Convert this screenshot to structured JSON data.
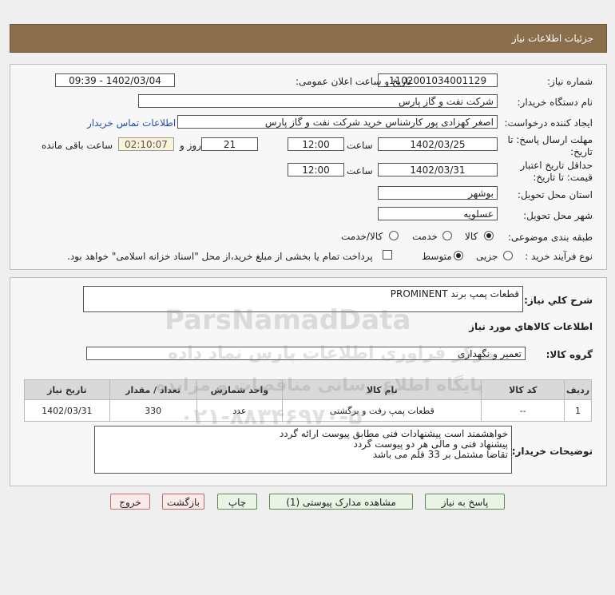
{
  "header": {
    "title": "جزئیات اطلاعات نیاز"
  },
  "form": {
    "need_number_label": "شماره نیاز:",
    "need_number": "1102001034001129",
    "announce_label": "تاریخ و ساعت اعلان عمومی:",
    "announce_value": "1402/03/04 - 09:39",
    "buyer_org_label": "نام دستگاه خریدار:",
    "buyer_org": "شرکت نفت و گاز پارس",
    "creator_label": "ایجاد کننده درخواست:",
    "creator": "اصغر کهزادی پور کارشناس خرید شرکت نفت و گاز پارس",
    "contact_link": "اطلاعات تماس خریدار",
    "deadline_label_1": "مهلت ارسال پاسخ: تا",
    "deadline_label_2": "تاریخ:",
    "deadline_date": "1402/03/25",
    "time_label": "ساعت",
    "deadline_time": "12:00",
    "days_value": "21",
    "days_label": "روز و",
    "remaining_time": "02:10:07",
    "remaining_label": "ساعت باقی مانده",
    "validity_label_1": "حداقل تاریخ اعتبار",
    "validity_label_2": "قیمت: تا تاریخ:",
    "validity_date": "1402/03/31",
    "validity_time_label": "ساعت",
    "validity_time": "12:00",
    "province_label": "استان محل تحویل:",
    "province": "بوشهر",
    "city_label": "شهر محل تحویل:",
    "city": "عسلویه",
    "category_label": "طبقه بندی موضوعی:",
    "category_options": [
      "کالا",
      "خدمت",
      "کالا/خدمت"
    ],
    "purchase_type_label": "نوع فرآیند خرید :",
    "purchase_options": [
      "جزیی",
      "متوسط"
    ],
    "payment_note": "پرداخت تمام یا بخشی از مبلغ خرید،از محل \"اسناد خزانه اسلامی\" خواهد بود."
  },
  "summary": {
    "general_label": "شرح کلي نياز:",
    "general_value": "قطعات پمپ برند PROMINENT",
    "goods_info_title": "اطلاعات کالاهاي مورد نياز",
    "group_label": "گروه کالا:",
    "group_value": "تعمیر و نگهداری",
    "table_headers": [
      "ردیف",
      "کد کالا",
      "نام کالا",
      "واحد شمارش",
      "تعداد / مقدار",
      "تاریخ نیاز"
    ],
    "rows": [
      [
        "1",
        "--",
        "قطعات پمپ رفت و برگشتی",
        "عدد",
        "330",
        "1402/03/31"
      ]
    ],
    "buyer_notes_label": "توضیحات خریدار:",
    "buyer_notes": [
      "خواهشمند است پیشنهادات فنی مطابق پیوست ارائه گردد",
      "پیشنهاد فنی و مالی هر دو پیوست گردد",
      "تقاضا مشتمل بر 33 قلم می باشد"
    ]
  },
  "buttons": {
    "reply": "پاسخ به نیاز",
    "attachments": "مشاهده مدارک پیوستی (1)",
    "print": "چاپ",
    "back": "بازگشت",
    "exit": "خروج"
  },
  "watermark": {
    "brand": "ParsNamadData",
    "line1": "مرکز فراوری اطلاعات پارس نماد داده",
    "line2": "پایگاه اطلاع رسانی مناقصات و مزایده",
    "phone": "۰۲۱-۸۸۳۴۶۹۷۰-۵"
  }
}
